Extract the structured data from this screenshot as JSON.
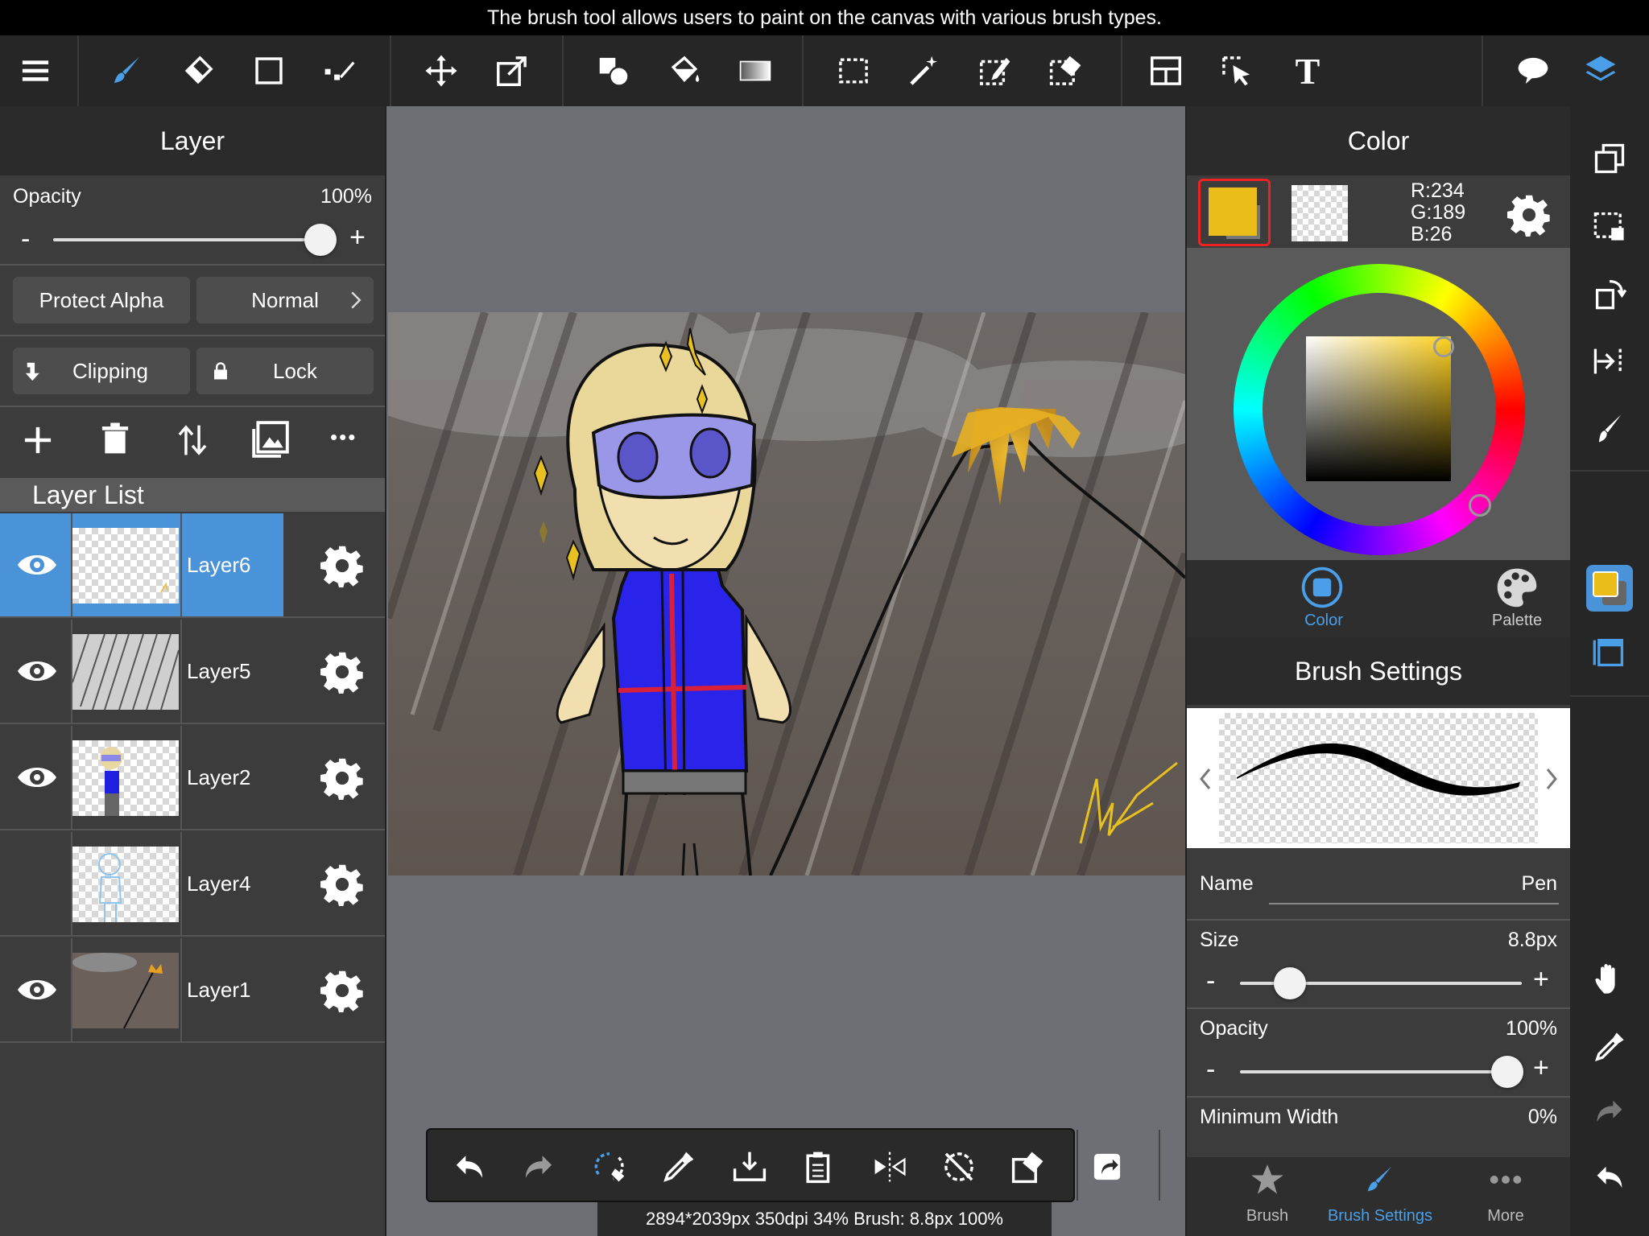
{
  "caption": "The brush tool allows users to paint on the canvas with various brush types.",
  "layer_panel": {
    "title": "Layer",
    "opacity_label": "Opacity",
    "opacity_value": "100%",
    "minus": "-",
    "plus": "+",
    "protect_alpha": "Protect Alpha",
    "blend_mode": "Normal",
    "clipping": "Clipping",
    "lock": "Lock",
    "more": "•••",
    "list_title": "Layer List",
    "layers": [
      {
        "name": "Layer6",
        "visible": true,
        "selected": true
      },
      {
        "name": "Layer5",
        "visible": true,
        "selected": false
      },
      {
        "name": "Layer2",
        "visible": true,
        "selected": false
      },
      {
        "name": "Layer4",
        "visible": false,
        "selected": false
      },
      {
        "name": "Layer1",
        "visible": true,
        "selected": false
      }
    ]
  },
  "color_panel": {
    "title": "Color",
    "foreground_color": "#eabd1a",
    "r": "R:234",
    "g": "G:189",
    "b": "B:26",
    "tab_color": "Color",
    "tab_palette": "Palette"
  },
  "brush_settings": {
    "title": "Brush Settings",
    "name_label": "Name",
    "name_value": "Pen",
    "size_label": "Size",
    "size_value": "8.8px",
    "opacity_label": "Opacity",
    "opacity_value": "100%",
    "min_width_label": "Minimum Width",
    "min_width_value": "0%",
    "minus": "-",
    "plus": "+"
  },
  "bottom_tabs": {
    "brush": "Brush",
    "brush_settings": "Brush Settings",
    "more": "More"
  },
  "status_bar": "2894*2039px 350dpi 34% Brush: 8.8px 100%",
  "text_tool": "T",
  "accent_color": "#4a93d9"
}
